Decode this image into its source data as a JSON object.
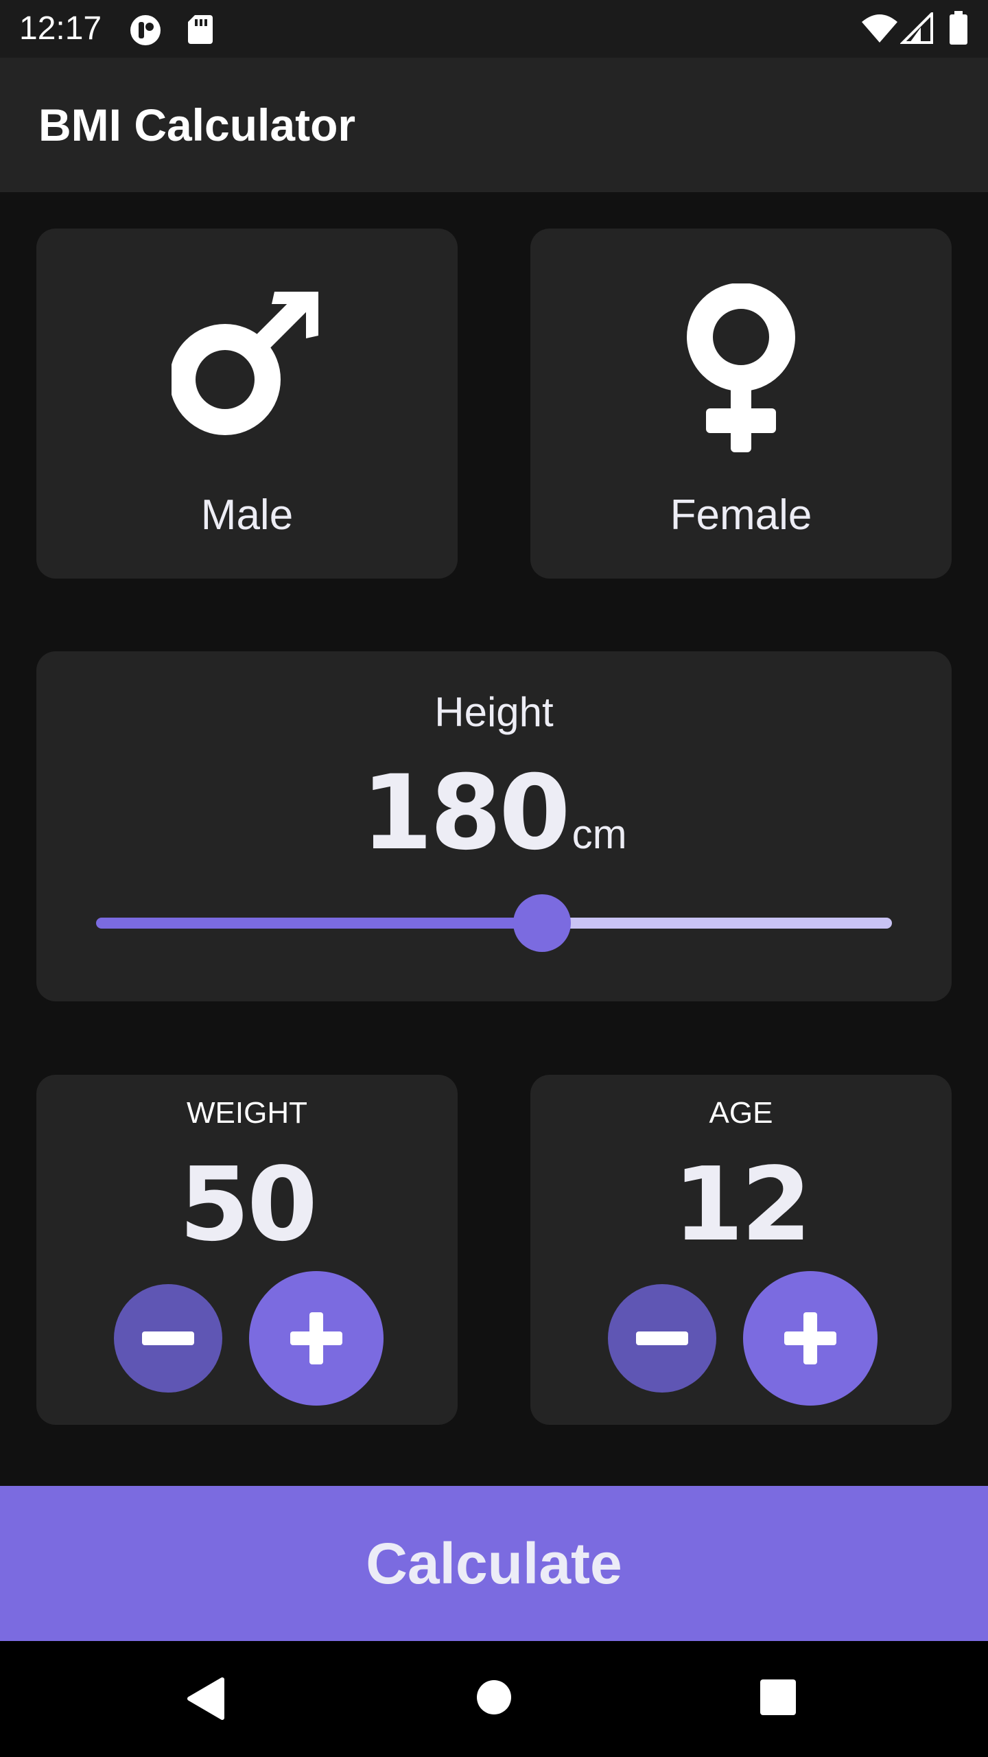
{
  "status_bar": {
    "time": "12:17"
  },
  "app_bar": {
    "title": "BMI Calculator"
  },
  "gender": {
    "male_label": "Male",
    "female_label": "Female"
  },
  "height": {
    "label": "Height",
    "value": "180",
    "unit": "cm",
    "slider_fraction": 0.56
  },
  "weight": {
    "label": "WEIGHT",
    "value": "50"
  },
  "age": {
    "label": "AGE",
    "value": "12"
  },
  "calculate_button": {
    "label": "Calculate"
  },
  "colors": {
    "accent": "#7b6be0",
    "accent_dark": "#5f56b4",
    "card": "#242424",
    "background": "#111111"
  },
  "icons": {
    "male": "male-symbol-icon",
    "female": "female-symbol-icon",
    "minus": "minus-icon",
    "plus": "plus-icon"
  }
}
